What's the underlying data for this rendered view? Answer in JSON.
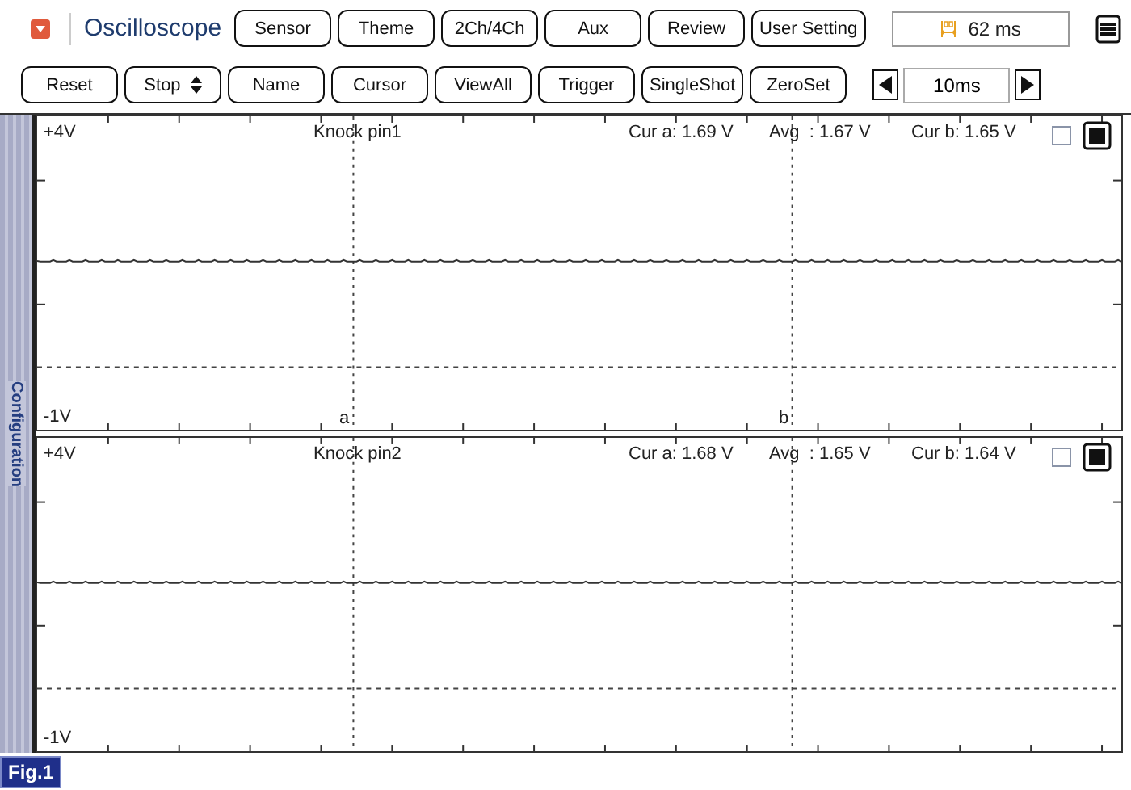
{
  "header": {
    "title": "Oscilloscope",
    "buttons": [
      "Sensor",
      "Theme",
      "2Ch/4Ch",
      "Aux",
      "Review",
      "User Setting"
    ],
    "time_reading": "62 ms"
  },
  "toolbar": {
    "buttons": [
      {
        "label": "Reset",
        "kind": "plain"
      },
      {
        "label": "Stop",
        "kind": "select"
      },
      {
        "label": "Name",
        "kind": "plain"
      },
      {
        "label": "Cursor",
        "kind": "plain"
      },
      {
        "label": "ViewAll",
        "kind": "plain"
      },
      {
        "label": "Trigger",
        "kind": "plain"
      },
      {
        "label": "SingleShot",
        "kind": "plain"
      },
      {
        "label": "ZeroSet",
        "kind": "plain"
      }
    ],
    "timebase": "10ms"
  },
  "sidebar": {
    "label": "Configuration"
  },
  "channels": [
    {
      "name": "Knock pin1",
      "top": "+4V",
      "bottom": "-1V",
      "cur_a": "Cur a: 1.69 V",
      "avg": "Avg  : 1.67 V",
      "cur_b": "Cur b: 1.65 V",
      "checked": false,
      "cursor_a": "a",
      "cursor_b": "b"
    },
    {
      "name": "Knock pin2",
      "top": "+4V",
      "bottom": "-1V",
      "cur_a": "Cur a: 1.68 V",
      "avg": "Avg  : 1.65 V",
      "cur_b": "Cur b: 1.64 V",
      "checked": false
    }
  ],
  "figure_label": "Fig.1"
}
